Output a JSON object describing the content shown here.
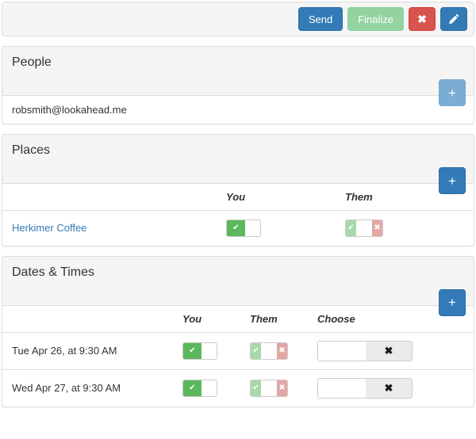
{
  "toolbar": {
    "send_label": "Send",
    "finalize_label": "Finalize",
    "cancel_icon": "✖",
    "edit_icon": "pencil-icon"
  },
  "colors": {
    "primary": "#337ab7",
    "primary_faded": "#7badd4",
    "success_muted": "#93d3a2",
    "danger": "#d9534f",
    "switch_on": "#5cb85c",
    "switch_on_faded": "#a8d8ae",
    "switch_off_faded": "#e4a6a4",
    "panel_header_bg": "#f5f5f5",
    "border": "#dddddd"
  },
  "people": {
    "title": "People",
    "add_label": "+",
    "entries": [
      {
        "email": "robsmith@lookahead.me"
      }
    ]
  },
  "places": {
    "title": "Places",
    "add_label": "+",
    "columns": [
      "",
      "You",
      "Them"
    ],
    "rows": [
      {
        "name": "Herkimer Coffee",
        "you": "on",
        "them": "indeterminate"
      }
    ]
  },
  "dates": {
    "title": "Dates & Times",
    "add_label": "+",
    "columns": [
      "",
      "You",
      "Them",
      "Choose"
    ],
    "rows": [
      {
        "when": "Tue Apr 26, at 9:30 AM",
        "you": "on",
        "them": "indeterminate",
        "choose": "off",
        "choose_icon": "✖"
      },
      {
        "when": "Wed Apr 27, at 9:30 AM",
        "you": "on",
        "them": "indeterminate",
        "choose": "off",
        "choose_icon": "✖"
      }
    ]
  },
  "switch_glyphs": {
    "check": "✔",
    "cross": "✖"
  }
}
